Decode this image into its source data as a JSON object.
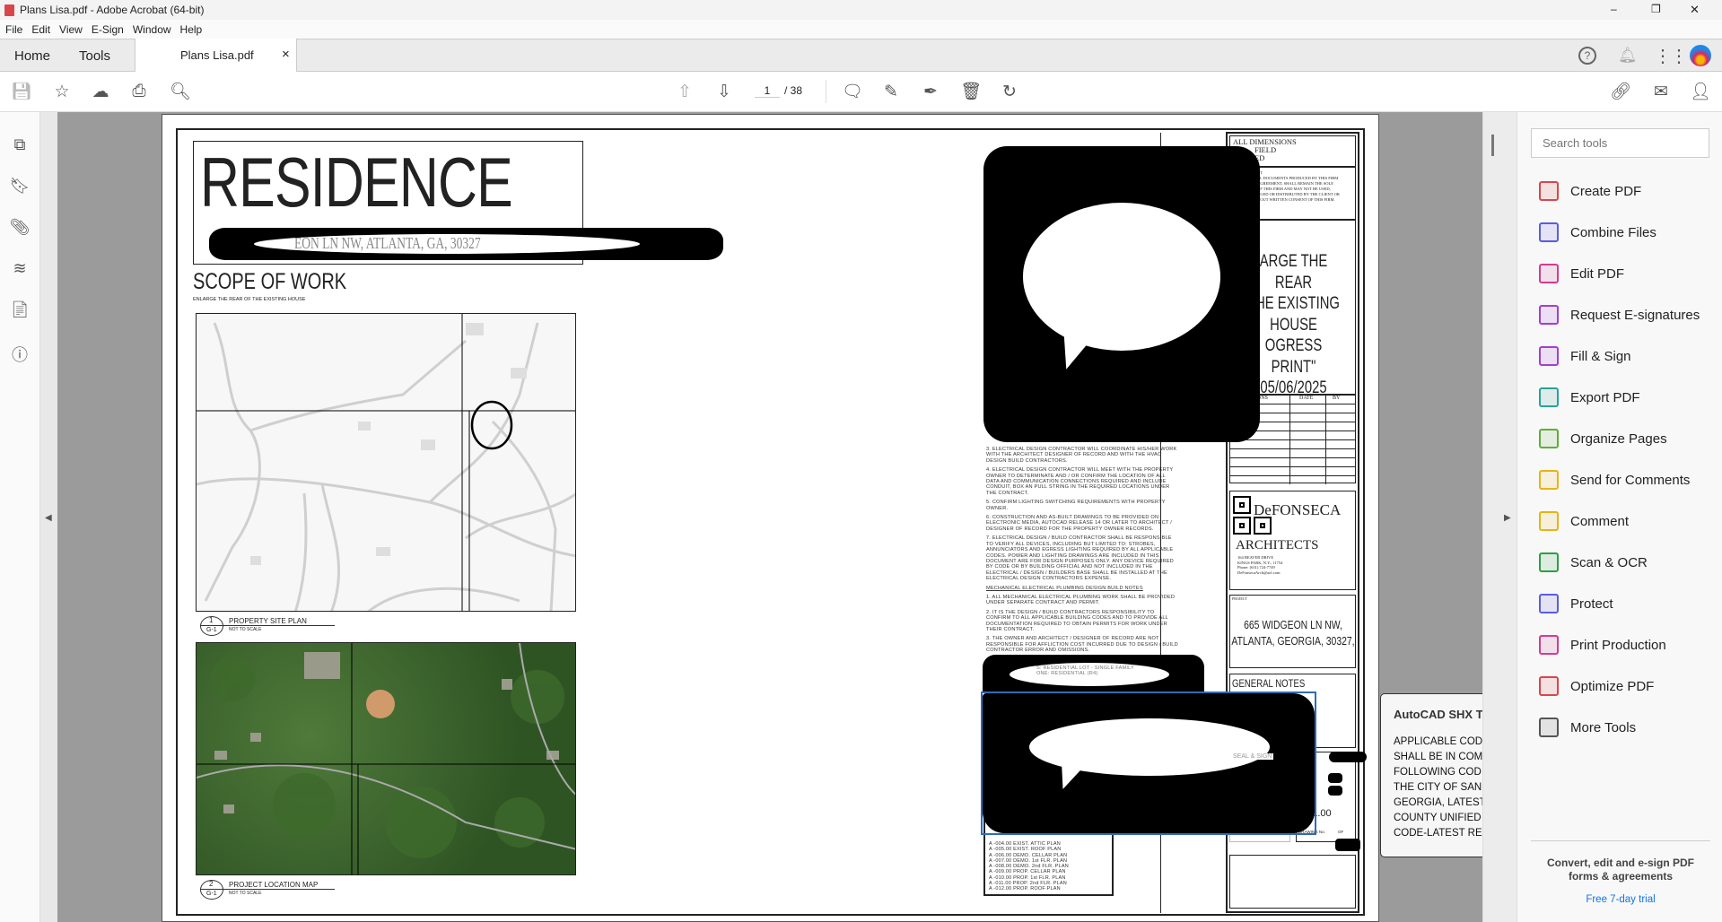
{
  "window": {
    "title": "Plans Lisa.pdf - Adobe Acrobat (64-bit)",
    "minimize": "–",
    "restore": "❐",
    "close": "✕"
  },
  "menu": [
    "File",
    "Edit",
    "View",
    "E-Sign",
    "Window",
    "Help"
  ],
  "tabs": {
    "home": "Home",
    "tools": "Tools",
    "document": "Plans Lisa.pdf",
    "close": "×"
  },
  "toolbar": {
    "page_current": "1",
    "page_total": "/ 38"
  },
  "right_panel": {
    "search_placeholder": "Search tools",
    "tools": [
      {
        "label": "Create PDF",
        "color": "#d9464a"
      },
      {
        "label": "Combine Files",
        "color": "#5b5ce2"
      },
      {
        "label": "Edit PDF",
        "color": "#d23d91"
      },
      {
        "label": "Request E-signatures",
        "color": "#a23fd1"
      },
      {
        "label": "Fill & Sign",
        "color": "#a23fd1"
      },
      {
        "label": "Export PDF",
        "color": "#2aa198"
      },
      {
        "label": "Organize Pages",
        "color": "#5fae3a"
      },
      {
        "label": "Send for Comments",
        "color": "#e7b416"
      },
      {
        "label": "Comment",
        "color": "#e7b416"
      },
      {
        "label": "Scan & OCR",
        "color": "#2f9e44"
      },
      {
        "label": "Protect",
        "color": "#5b5ce2"
      },
      {
        "label": "Print Production",
        "color": "#d23d91"
      },
      {
        "label": "Optimize PDF",
        "color": "#d9464a"
      },
      {
        "label": "More Tools",
        "color": "#555555"
      }
    ],
    "promo": "Convert, edit and e-sign PDF forms & agreements",
    "trial": "Free 7-day trial"
  },
  "tooltip": {
    "title": "AutoCAD SHX T",
    "lines": [
      "APPLICABLE CODE",
      "SHALL BE IN COM",
      "FOLLOWING COD",
      "THE CITY OF SAN",
      "GEORGIA, LATEST",
      "COUNTY  UNIFIED",
      "CODE-LATEST RE"
    ]
  },
  "drawing": {
    "title": "RESIDENCE",
    "address_redacted": "EON LN NW, ATLANTA, GA, 30327",
    "scope_title": "SCOPE OF WORK",
    "scope_text": "ENLARGE THE REAR OF THE EXISTING HOUSE",
    "view1": {
      "num": "1",
      "sheet": "G-1",
      "title": "PROPERTY SITE PLAN",
      "scale": "NOT TO SCALE"
    },
    "view2": {
      "num": "2",
      "sheet": "G-1",
      "title": "PROJECT LOCATION MAP",
      "scale": "NOT TO SCALE"
    },
    "notes": [
      "3. ELECTRICAL DESIGN CONTRACTOR WILL COORDINATE HIS/HER WORK WITH THE ARCHITECT DESIGNER OF RECORD AND WITH THE HVAC DESIGN BUILD CONTRACTORS.",
      "4. ELECTRICAL DESIGN CONTRACTOR WILL MEET WITH THE PROPERTY OWNER TO DETERMINATE AND / OR CONFIRM THE LOCATION OF ALL DATA AND COMMUNICATION CONNECTIONS REQUIRED AND INCLUDE CONDUIT, BOX AN PULL STRING IN THE REQUIRED LOCATIONS UNDER THE CONTRACT.",
      "5. CONFIRM LIGHTING SWITCHING REQUIREMENTS WITH PROPERTY OWNER.",
      "6. CONSTRUCTION AND AS-BUILT DRAWINGS TO BE PROVIDED ON ELECTRONIC MEDIA, AUTOCAD RELEASE 14 OR LATER TO ARCHITECT / DESIGNER OF RECORD FOR THE PROPERTY OWNER RECORDS.",
      "7. ELECTRICAL DESIGN / BUILD CONTRACTOR SHALL BE RESPONSIBLE TO VERIFY ALL DEVICES, INCLUDING BUT LIMITED TO: STROBES, ANNUNCIATORS AND EGRESS LIGHTING REQUIRED BY ALL APPLICABLE CODES. POWER AND LIGHTING DRAWINGS ARE INCLUDED IN THIS DOCUMENT ARE FOR DESIGN PURPOSES ONLY. ANY DEVICE REQUIRED BY CODE OR BY BUILDING OFFICIAL AND NOT INCLUDED IN THE ELECTRICAL / DESIGN / BUILDERS BASE SHALL BE INSTALLED AT THE ELECTRICAL DESIGN CONTRACTORS EXPENSE.",
      "MECHANICAL ELECTRICAL PLUMBING DESIGN BUILD NOTES",
      "1. ALL MECHANICAL ELECTRICAL PLUMBING WORK SHALL BE PROVIDED UNDER SEPARATE CONTRACT AND PERMIT.",
      "2. IT IS THE DESIGN / BUILD CONTRACTORS RESPONSIBILITY TO CONFIRM TO ALL APPLICABLE BUILDING CODES AND TO PROVIDE ALL DOCUMENTATION REQUIRED TO OBTAIN PERMITS FOR WORK UNDER THEIR CONTRACT.",
      "3. THE OWNER AND ARCHITECT / DESIGNER OF RECORD ARE NOT RESPONSIBLE FOR AFFLICTION COST INCURRED DUE TO DESIGN / BUILD CONTRACTOR ERROR AND OMISSIONS."
    ],
    "zoning": [
      "S: RESIDENTIAL LOT - SINGLE FAMILY",
      "ONE: RESIDENTIAL (R4)"
    ],
    "sheets": [
      "A -004.00 EXIST.  ATTIC PLAN",
      "A -005.00 EXIST.  ROOF PLAN",
      "A -006.00 DEMO.  CELLAR PLAN",
      "A -007.00 DEMO.  1st FLR. PLAN",
      "A -008.00 DEMO.  2nd FLR. PLAN",
      "A -009.00 PROP.  CELLAR PLAN",
      "A -010.00 PROP.  1st FLR. PLAN",
      "A -011.00 PROP.  2nd FLR. PLAN",
      "A -012.00 PROP.  ROOF PLAN"
    ],
    "titleblock": {
      "dims": [
        "ALL DIMENSIONS",
        "FIELD",
        "ED"
      ],
      "copyright_head": "HT",
      "copyright": [
        "LL DOCUMENTS PRODUCED BY THIS FIRM",
        "AGREEMENT, SHALL REMAIN THE SOLE",
        "OF THIS FIRM AND MAY NOT BE USED,",
        "NGED OR DISTRIBUTED BY THE CLIENT OR",
        "HOUT WRITTEN CONSENT OF THIS FIRM."
      ],
      "description": [
        "ARGE THE REAR",
        "THE EXISTING",
        "HOUSE",
        "OGRESS PRINT\"",
        "05/06/2025"
      ],
      "rev_headers": [
        "ONS",
        "DATE",
        "BY"
      ],
      "firm": "DeFONSECA",
      "firm2": "ARCHITECTS",
      "firm_addr": [
        "164 BEAVER DRIVE",
        "KINGS PARK, N.Y., 11754",
        "Phone: (631) 724-7749",
        "DeFonsecaArch@aol.com"
      ],
      "project_label": "PROJECT",
      "project": [
        "665 WIDGEON LN NW,",
        "ATLANTA, GEORGIA, 30327,"
      ],
      "general_notes": "GENERAL NOTES",
      "seal": "SEAL & SIGN",
      "sheet_no": "001.00",
      "drawing_no": "DRAWING No.",
      "of": "OF"
    }
  }
}
